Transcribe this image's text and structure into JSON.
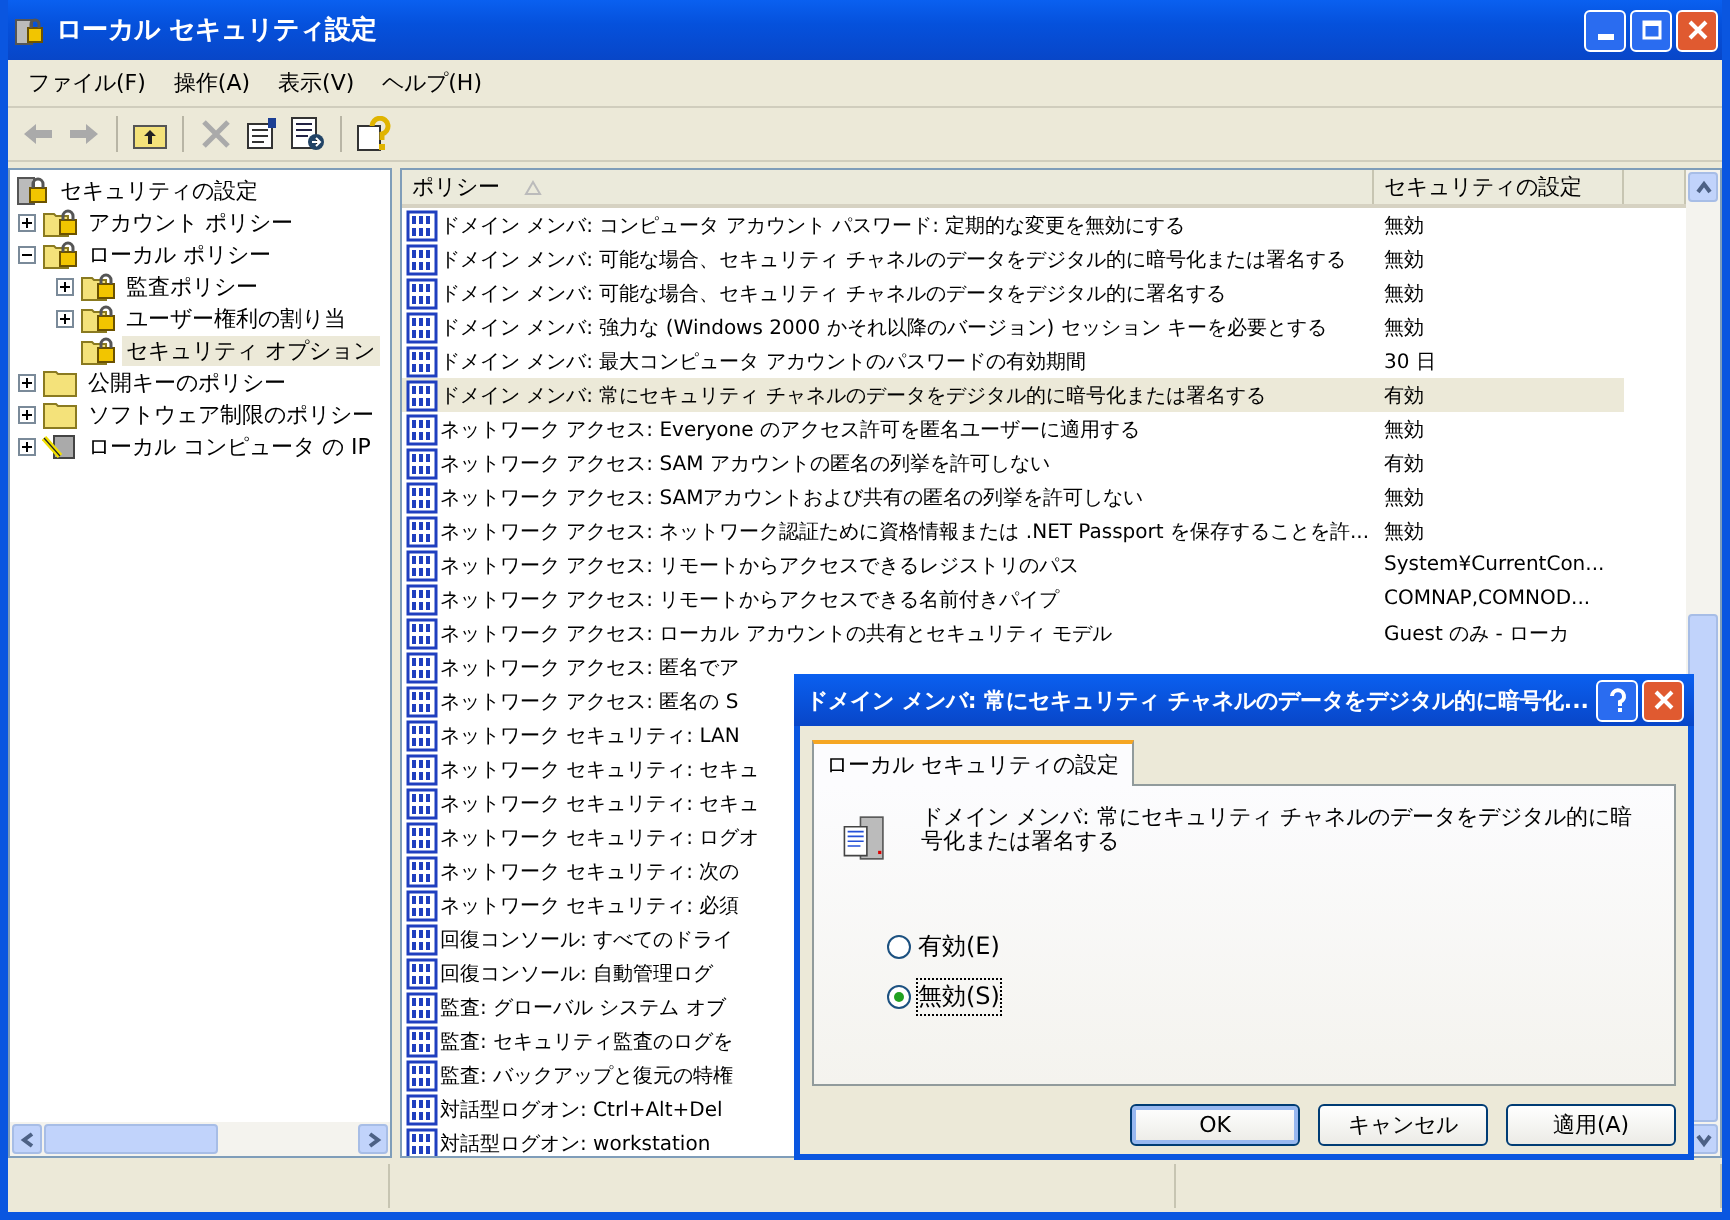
{
  "window": {
    "title": "ローカル セキュリティ設定"
  },
  "menu": [
    "ファイル(F)",
    "操作(A)",
    "表示(V)",
    "ヘルプ(H)"
  ],
  "toolbar": [
    {
      "kind": "back",
      "disabled": true
    },
    {
      "kind": "forward",
      "disabled": true
    },
    {
      "kind": "sep"
    },
    {
      "kind": "up",
      "disabled": false
    },
    {
      "kind": "sep"
    },
    {
      "kind": "delete",
      "disabled": true
    },
    {
      "kind": "properties",
      "disabled": false
    },
    {
      "kind": "export",
      "disabled": false
    },
    {
      "kind": "sep"
    },
    {
      "kind": "help",
      "disabled": false
    }
  ],
  "tree": [
    {
      "label": "セキュリティの設定",
      "kind": "root",
      "selected": false,
      "children": [
        {
          "label": "アカウント ポリシー",
          "kind": "secure-folder",
          "selected": false,
          "expanded": false
        },
        {
          "label": "ローカル ポリシー",
          "kind": "secure-folder",
          "selected": false,
          "expanded": true,
          "children": [
            {
              "label": "監査ポリシー",
              "kind": "secure-folder",
              "selected": false,
              "expanded": false
            },
            {
              "label": "ユーザー権利の割り当",
              "kind": "secure-folder",
              "selected": false,
              "expanded": false
            },
            {
              "label": "セキュリティ オプション",
              "kind": "secure-folder",
              "selected": true
            }
          ]
        },
        {
          "label": "公開キーのポリシー",
          "kind": "folder",
          "selected": false,
          "expanded": false
        },
        {
          "label": "ソフトウェア制限のポリシー",
          "kind": "folder",
          "selected": false,
          "expanded": false
        },
        {
          "label": "ローカル コンピュータ の IP",
          "kind": "ip-policy",
          "selected": false,
          "expanded": false
        }
      ]
    }
  ],
  "table": {
    "columns": [
      {
        "label": "ポリシー",
        "sorted": true
      },
      {
        "label": "セキュリティの設定",
        "sorted": false
      }
    ],
    "rows": [
      {
        "policy": "ドメイン メンバ: コンピュータ アカウント パスワード: 定期的な変更を無効にする",
        "setting": "無効",
        "selected": false
      },
      {
        "policy": "ドメイン メンバ: 可能な場合、セキュリティ チャネルのデータをデジタル的に暗号化または署名する",
        "setting": "無効",
        "selected": false
      },
      {
        "policy": "ドメイン メンバ: 可能な場合、セキュリティ チャネルのデータをデジタル的に署名する",
        "setting": "無効",
        "selected": false
      },
      {
        "policy": "ドメイン メンバ: 強力な (Windows 2000 かそれ以降のバージョン) セッション キーを必要とする",
        "setting": "無効",
        "selected": false
      },
      {
        "policy": "ドメイン メンバ: 最大コンピュータ アカウントのパスワードの有効期間",
        "setting": "30 日",
        "selected": false
      },
      {
        "policy": "ドメイン メンバ: 常にセキュリティ チャネルのデータをデジタル的に暗号化または署名する",
        "setting": "有効",
        "selected": true
      },
      {
        "policy": "ネットワーク アクセス: Everyone のアクセス許可を匿名ユーザーに適用する",
        "setting": "無効",
        "selected": false
      },
      {
        "policy": "ネットワーク アクセス: SAM アカウントの匿名の列挙を許可しない",
        "setting": "有効",
        "selected": false
      },
      {
        "policy": "ネットワーク アクセス: SAMアカウントおよび共有の匿名の列挙を許可しない",
        "setting": "無効",
        "selected": false
      },
      {
        "policy": "ネットワーク アクセス: ネットワーク認証ために資格情報または .NET Passport を保存することを許...",
        "setting": "無効",
        "selected": false
      },
      {
        "policy": "ネットワーク アクセス: リモートからアクセスできるレジストリのパス",
        "setting": "System¥CurrentCon...",
        "selected": false
      },
      {
        "policy": "ネットワーク アクセス: リモートからアクセスできる名前付きパイプ",
        "setting": "COMNAP,COMNOD...",
        "selected": false
      },
      {
        "policy": "ネットワーク アクセス: ローカル アカウントの共有とセキュリティ モデル",
        "setting": "Guest のみ - ローカ",
        "selected": false
      },
      {
        "policy": "ネットワーク アクセス: 匿名でア",
        "selected": false
      },
      {
        "policy": "ネットワーク アクセス: 匿名の S",
        "selected": false
      },
      {
        "policy": "ネットワーク セキュリティ: LAN",
        "selected": false
      },
      {
        "policy": "ネットワーク セキュリティ: セキュ",
        "selected": false
      },
      {
        "policy": "ネットワーク セキュリティ: セキュ",
        "selected": false
      },
      {
        "policy": "ネットワーク セキュリティ: ログオ",
        "selected": false
      },
      {
        "policy": "ネットワーク セキュリティ: 次の",
        "selected": false
      },
      {
        "policy": "ネットワーク セキュリティ: 必須",
        "selected": false
      },
      {
        "policy": "回復コンソール: すべてのドライ",
        "selected": false
      },
      {
        "policy": "回復コンソール: 自動管理ログ",
        "selected": false
      },
      {
        "policy": "監査: グローバル システム オブ",
        "selected": false
      },
      {
        "policy": "監査: セキュリティ監査のログを",
        "selected": false
      },
      {
        "policy": "監査: バックアップと復元の特権",
        "selected": false
      },
      {
        "policy": "対話型ログオン: Ctrl+Alt+Del",
        "selected": false
      },
      {
        "policy": "対話型ログオン: workstation",
        "selected": false
      }
    ]
  },
  "dialog": {
    "title": "ドメイン メンバ: 常にセキュリティ チャネルのデータをデジタル的に暗号化...",
    "tab": {
      "label": "ローカル セキュリティの設定",
      "selected": true
    },
    "description": "ドメイン メンバ: 常にセキュリティ チャネルのデータをデジタル的に暗号化または署名する",
    "options": [
      {
        "label": "有効(E)",
        "selected": false
      },
      {
        "label": "無効(S)",
        "selected": true
      }
    ],
    "buttons": [
      {
        "label": "OK",
        "default": true
      },
      {
        "label": "キャンセル",
        "default": false
      },
      {
        "label": "適用(A)",
        "default": false
      }
    ]
  }
}
